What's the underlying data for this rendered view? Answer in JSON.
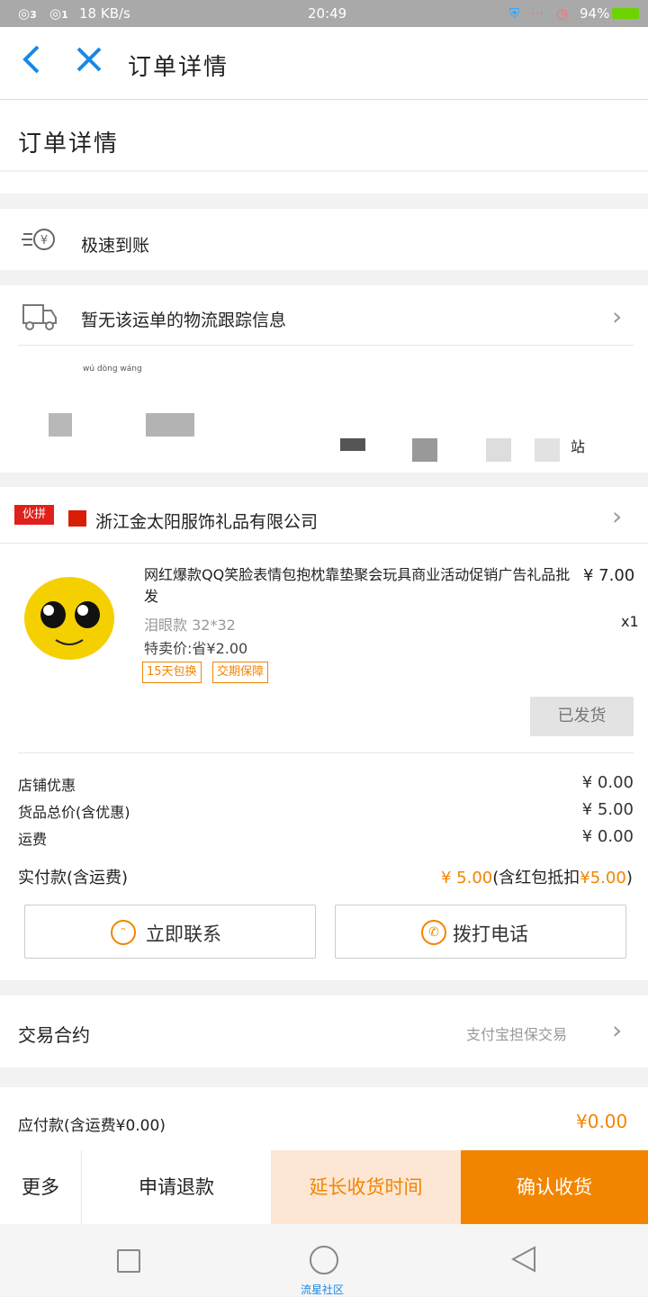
{
  "status_bar": {
    "notif_count_1": "3",
    "notif_count_2": "1",
    "speed": "18 KB/s",
    "time": "20:49",
    "battery": "94%"
  },
  "nav": {
    "title": "订单详情",
    "back_icon": "back-arrow-icon",
    "close_icon": "close-icon"
  },
  "header": {
    "title": "订单详情"
  },
  "refund": {
    "label": "极速到账",
    "icon": "fast-money-icon"
  },
  "logistics": {
    "label": "暂无该运单的物流跟踪信息",
    "icon": "truck-icon"
  },
  "address": {
    "small_label": "wú dòng wáng",
    "station_suffix": "站"
  },
  "shop": {
    "badge": "伙拼",
    "name": "浙江金太阳服饰礼品有限公司"
  },
  "product": {
    "title": "网红爆款QQ笑脸表情包抱枕靠垫聚会玩具商业活动促销广告礼品批发",
    "price": "¥ 7.00",
    "qty": "x1",
    "spec": "泪眼款 32*32",
    "discount": "特卖价:省¥2.00",
    "tags": [
      "15天包换",
      "交期保障"
    ],
    "status_button": "已发货"
  },
  "summary": {
    "rows": [
      {
        "label": "店铺优惠",
        "value": "¥ 0.00"
      },
      {
        "label": "货品总价(含优惠)",
        "value": "¥ 5.00"
      },
      {
        "label": "运费",
        "value": "¥ 0.00"
      }
    ],
    "paid_label": "实付款(含运费)",
    "paid_value": "¥ 5.00",
    "paid_note_prefix": "(含红包抵扣",
    "paid_note_value": "¥5.00",
    "paid_note_suffix": ")"
  },
  "contact": {
    "chat_label": "立即联系",
    "call_label": "拨打电话"
  },
  "agreement": {
    "label": "交易合约",
    "value": "支付宝担保交易"
  },
  "payable": {
    "label": "应付款(含运费¥0.00)",
    "value": "¥0.00"
  },
  "bottom_bar": {
    "more": "更多",
    "refund": "申请退款",
    "extend": "延长收货时间",
    "confirm": "确认收货"
  },
  "system_nav": {
    "app_name": "流星社区"
  },
  "colors": {
    "accent_orange": "#f28500",
    "accent_blue": "#1a88e6",
    "extend_bg": "#fde6d4"
  }
}
